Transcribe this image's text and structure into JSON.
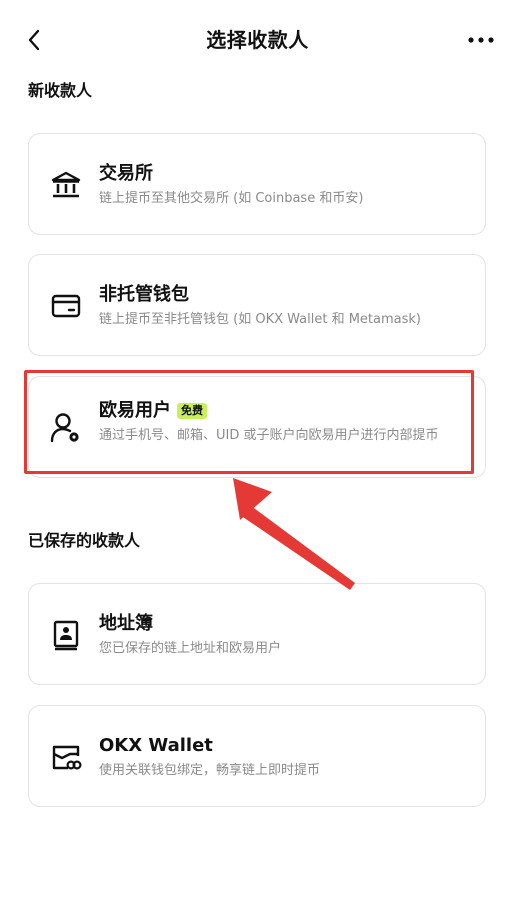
{
  "header": {
    "title": "选择收款人",
    "back_icon": "chevron-left-icon",
    "more_icon": "more-horizontal-icon"
  },
  "sections": {
    "new_payee": "新收款人",
    "saved_payee": "已保存的收款人"
  },
  "cards": {
    "exchange": {
      "title": "交易所",
      "subtitle": "链上提币至其他交易所 (如 Coinbase 和币安)",
      "icon": "bank-icon"
    },
    "wallet": {
      "title": "非托管钱包",
      "subtitle": "链上提币至非托管钱包 (如 OKX Wallet 和 Metamask)",
      "icon": "wallet-icon"
    },
    "okx_user": {
      "title": "欧易用户",
      "badge": "免费",
      "subtitle": "通过手机号、邮箱、UID 或子账户向欧易用户进行内部提币",
      "icon": "user-gear-icon"
    },
    "address_book": {
      "title": "地址簿",
      "subtitle": "您已保存的链上地址和欧易用户",
      "icon": "contact-book-icon"
    },
    "okx_wallet": {
      "title": "OKX Wallet",
      "subtitle": "使用关联钱包绑定，畅享链上即时提币",
      "icon": "link-wallet-icon"
    }
  },
  "colors": {
    "accent_badge": "#c8f05a",
    "highlight": "#e53935",
    "border": "#e3e3e3",
    "subtext": "#8a8a8a"
  }
}
